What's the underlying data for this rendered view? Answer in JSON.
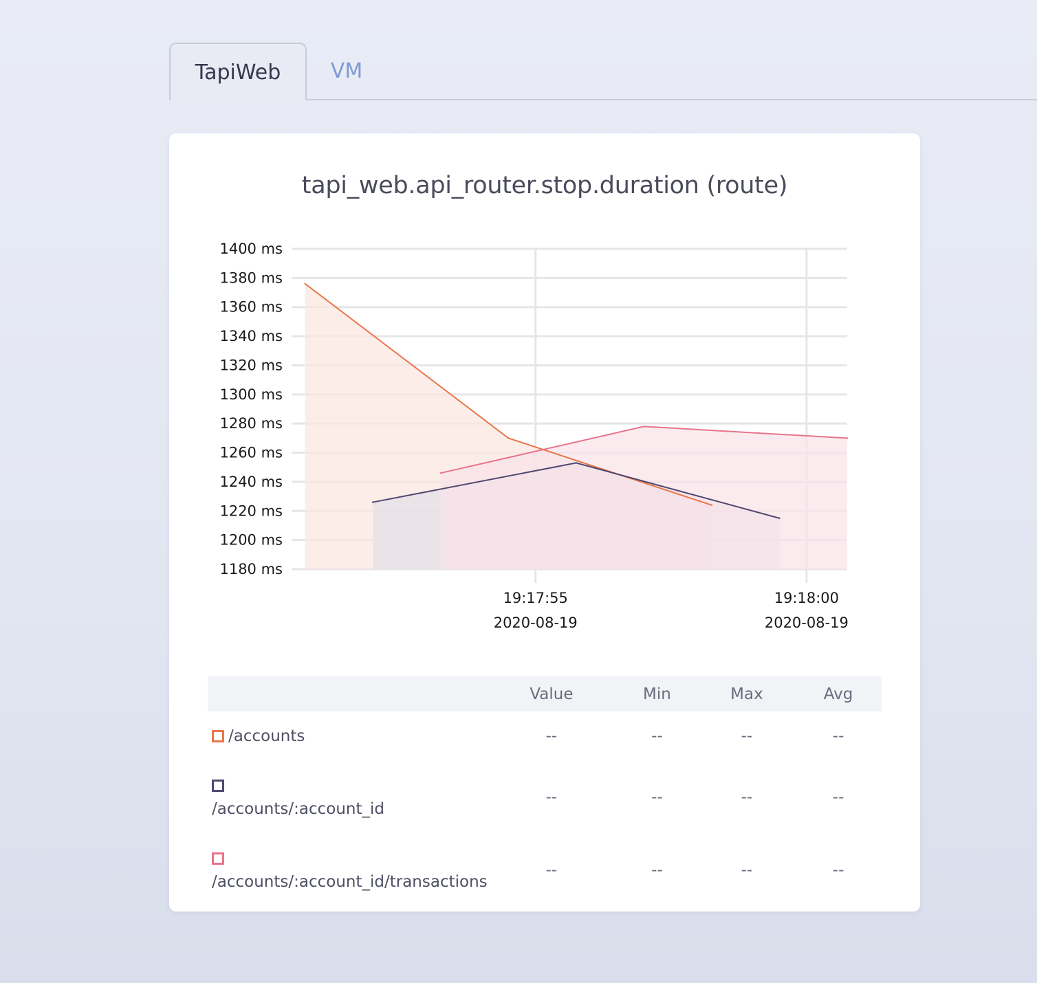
{
  "tabs": [
    {
      "label": "TapiWeb",
      "active": true
    },
    {
      "label": "VM",
      "active": false
    }
  ],
  "chart_data": {
    "type": "area",
    "title": "tapi_web.api_router.stop.duration (route)",
    "y_unit": "ms",
    "ylim": [
      1180,
      1400
    ],
    "y_ticks": [
      "1400 ms",
      "1380 ms",
      "1360 ms",
      "1340 ms",
      "1320 ms",
      "1300 ms",
      "1280 ms",
      "1260 ms",
      "1240 ms",
      "1220 ms",
      "1200 ms",
      "1180 ms"
    ],
    "x_ticks": [
      {
        "time": "19:17:55",
        "date": "2020-08-19"
      },
      {
        "time": "19:18:00",
        "date": "2020-08-19"
      }
    ],
    "xlim": [
      "2020-08-19 19:17:50.5",
      "2020-08-19 19:18:00.75"
    ],
    "grid": true,
    "series": [
      {
        "name": "/accounts",
        "color": "#e8764a",
        "fill": "#fbe6df",
        "x": [
          "2020-08-19 19:17:50.75",
          "2020-08-19 19:17:54.5",
          "2020-08-19 19:17:58.25"
        ],
        "values": [
          1376,
          1270,
          1224
        ]
      },
      {
        "name": "/accounts/:account_id",
        "color": "#4f4870",
        "fill": "#e3dfe8",
        "x": [
          "2020-08-19 19:17:52",
          "2020-08-19 19:17:55.75",
          "2020-08-19 19:17:59.5"
        ],
        "values": [
          1226,
          1253,
          1215
        ]
      },
      {
        "name": "/accounts/:account_id/transactions",
        "color": "#e8748a",
        "fill": "#f9e3e9",
        "x": [
          "2020-08-19 19:17:53.25",
          "2020-08-19 19:17:57",
          "2020-08-19 19:18:00.75"
        ],
        "values": [
          1246,
          1278,
          1270
        ]
      }
    ]
  },
  "legend_table": {
    "headers": [
      "",
      "Value",
      "Min",
      "Max",
      "Avg"
    ],
    "rows": [
      {
        "name": "/accounts",
        "color": "#e8764a",
        "value": "--",
        "min": "--",
        "max": "--",
        "avg": "--"
      },
      {
        "name": "/accounts/:account_id",
        "color": "#4f4870",
        "value": "--",
        "min": "--",
        "max": "--",
        "avg": "--"
      },
      {
        "name": "/accounts/:account_id/transactions",
        "color": "#e8748a",
        "value": "--",
        "min": "--",
        "max": "--",
        "avg": "--"
      }
    ]
  }
}
